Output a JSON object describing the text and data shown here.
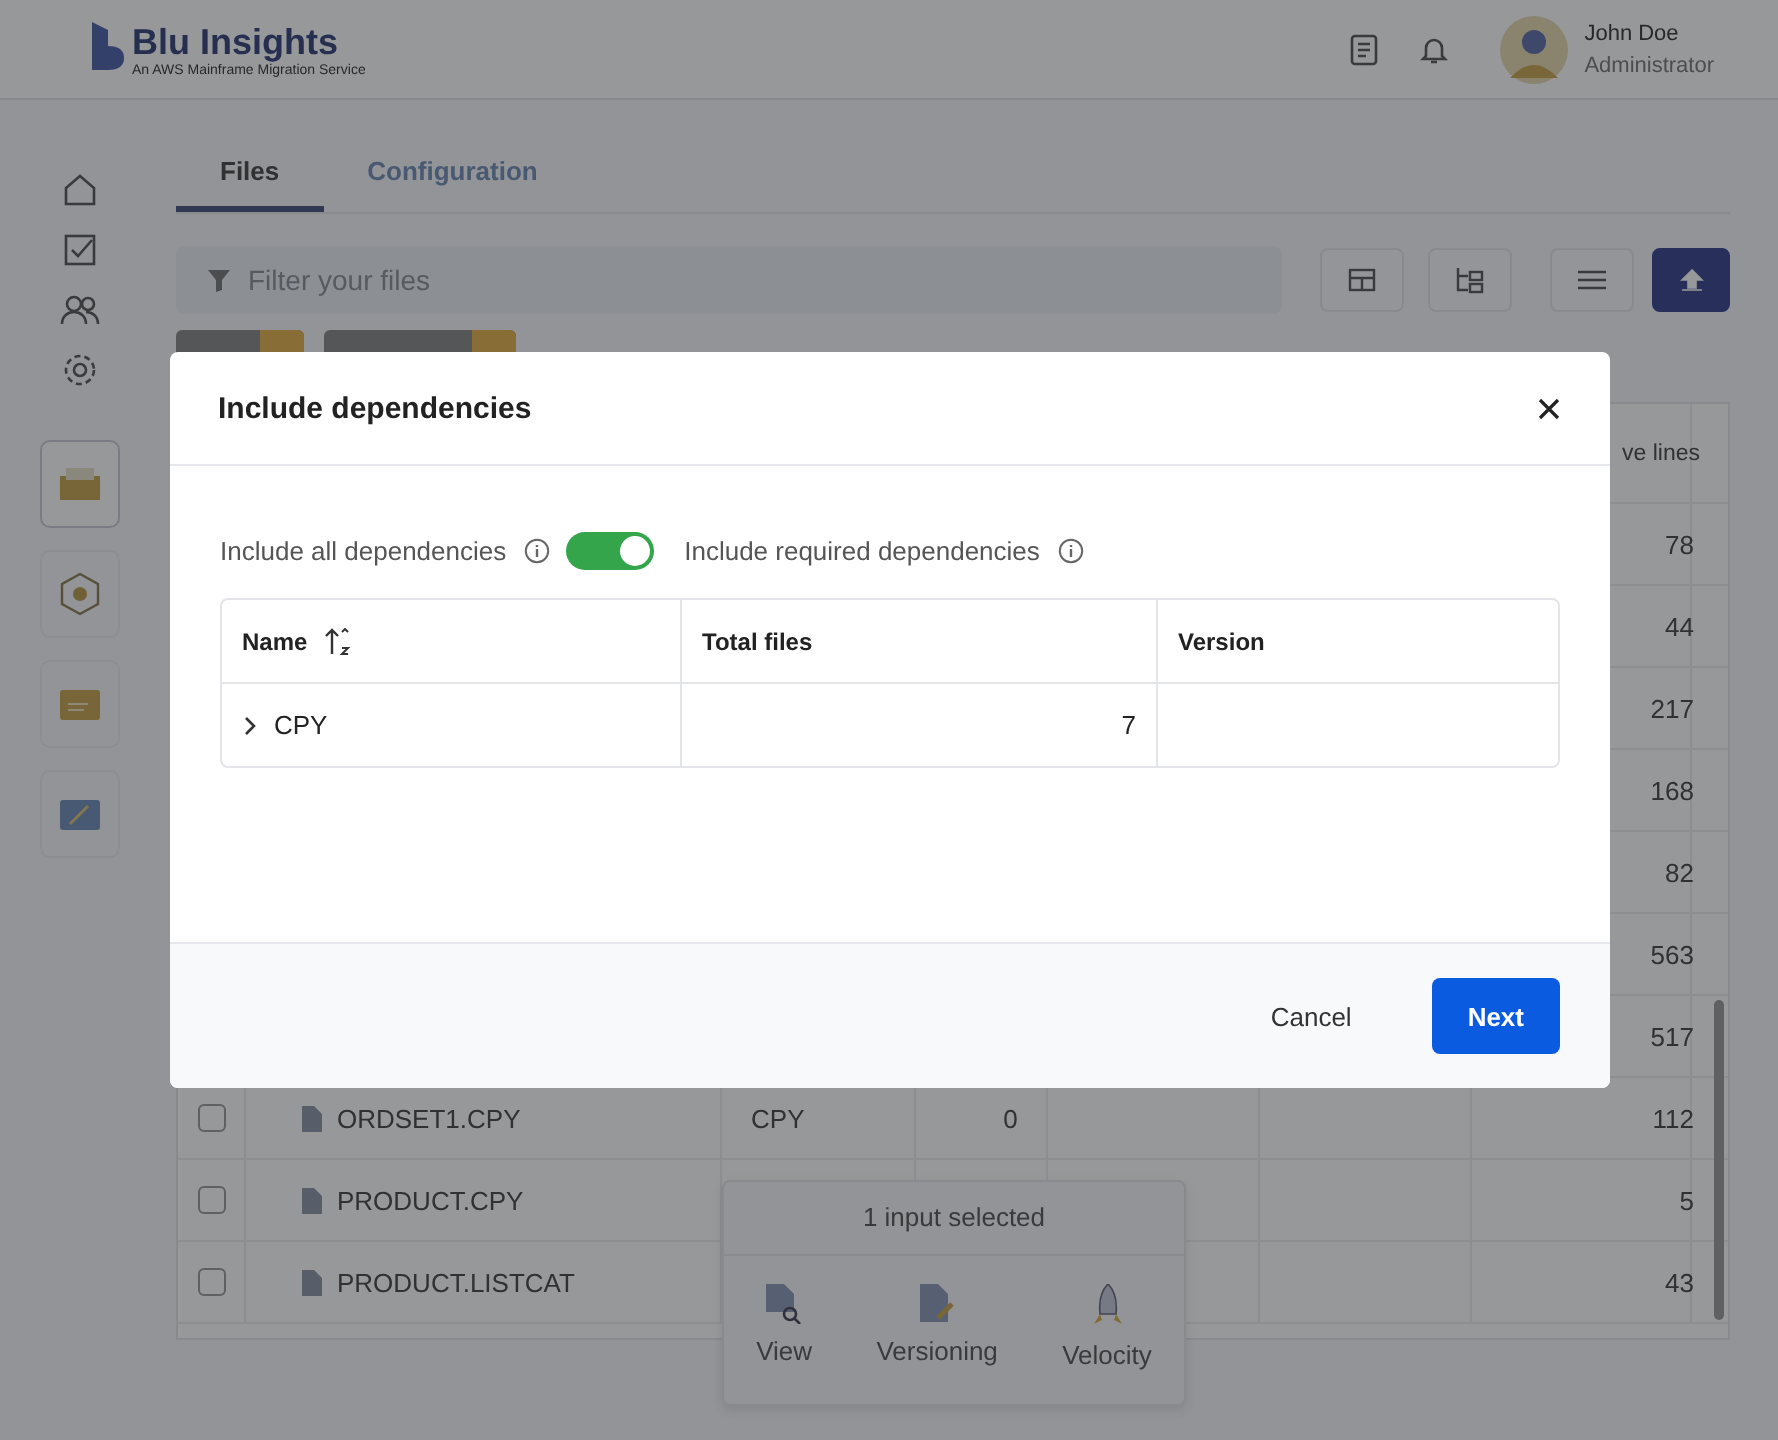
{
  "header": {
    "brand": "Blu Insights",
    "tagline": "An AWS Mainframe Migration Service",
    "user": {
      "name": "John Doe",
      "role": "Administrator"
    }
  },
  "sidebar": {
    "nav": [
      {
        "kind": "home"
      },
      {
        "kind": "check"
      },
      {
        "kind": "users"
      },
      {
        "kind": "gear"
      }
    ],
    "apps": [
      {
        "kind": "box",
        "selected": true
      },
      {
        "kind": "hexagon",
        "selected": false
      },
      {
        "kind": "folder",
        "selected": false
      },
      {
        "kind": "screen",
        "selected": false
      }
    ]
  },
  "tabs": [
    {
      "label": "Files",
      "selected": true
    },
    {
      "label": "Configuration",
      "selected": false
    }
  ],
  "filter": {
    "placeholder": "Filter your files"
  },
  "files_table": {
    "column_8": "ve lines",
    "rows": [
      {
        "column_8": "78"
      },
      {
        "column_8": "44"
      },
      {
        "column_8": "217"
      },
      {
        "column_8": "168"
      },
      {
        "column_8": "82"
      },
      {
        "column_8": "563"
      },
      {
        "column_8": "517"
      },
      {
        "checked": false,
        "name": "ORDSET1.CPY",
        "type": "CPY",
        "column_4": "0",
        "column_8": "112"
      },
      {
        "checked": false,
        "name": "PRODUCT.CPY",
        "column_8": "5"
      },
      {
        "checked": false,
        "name": "PRODUCT.LISTCAT",
        "column_8": "43"
      }
    ]
  },
  "selection_bar": {
    "title": "1 input selected",
    "actions": [
      {
        "label": "View",
        "kind": "view"
      },
      {
        "label": "Versioning",
        "kind": "versioning"
      },
      {
        "label": "Velocity",
        "kind": "velocity"
      }
    ]
  },
  "dialog": {
    "title": "Include dependencies",
    "left_label": "Include all dependencies",
    "switch": {
      "on": true
    },
    "right_label": "Include required dependencies",
    "columns": [
      {
        "label": "Name",
        "sortable": true
      },
      {
        "label": "Total files",
        "sortable": false
      },
      {
        "label": "Version",
        "sortable": false
      }
    ],
    "rows": [
      {
        "name": "CPY",
        "total_files": "7",
        "expanded": false
      }
    ],
    "buttons": [
      {
        "label": "Cancel",
        "kind": "secondary"
      },
      {
        "label": "Next",
        "kind": "primary"
      }
    ]
  }
}
